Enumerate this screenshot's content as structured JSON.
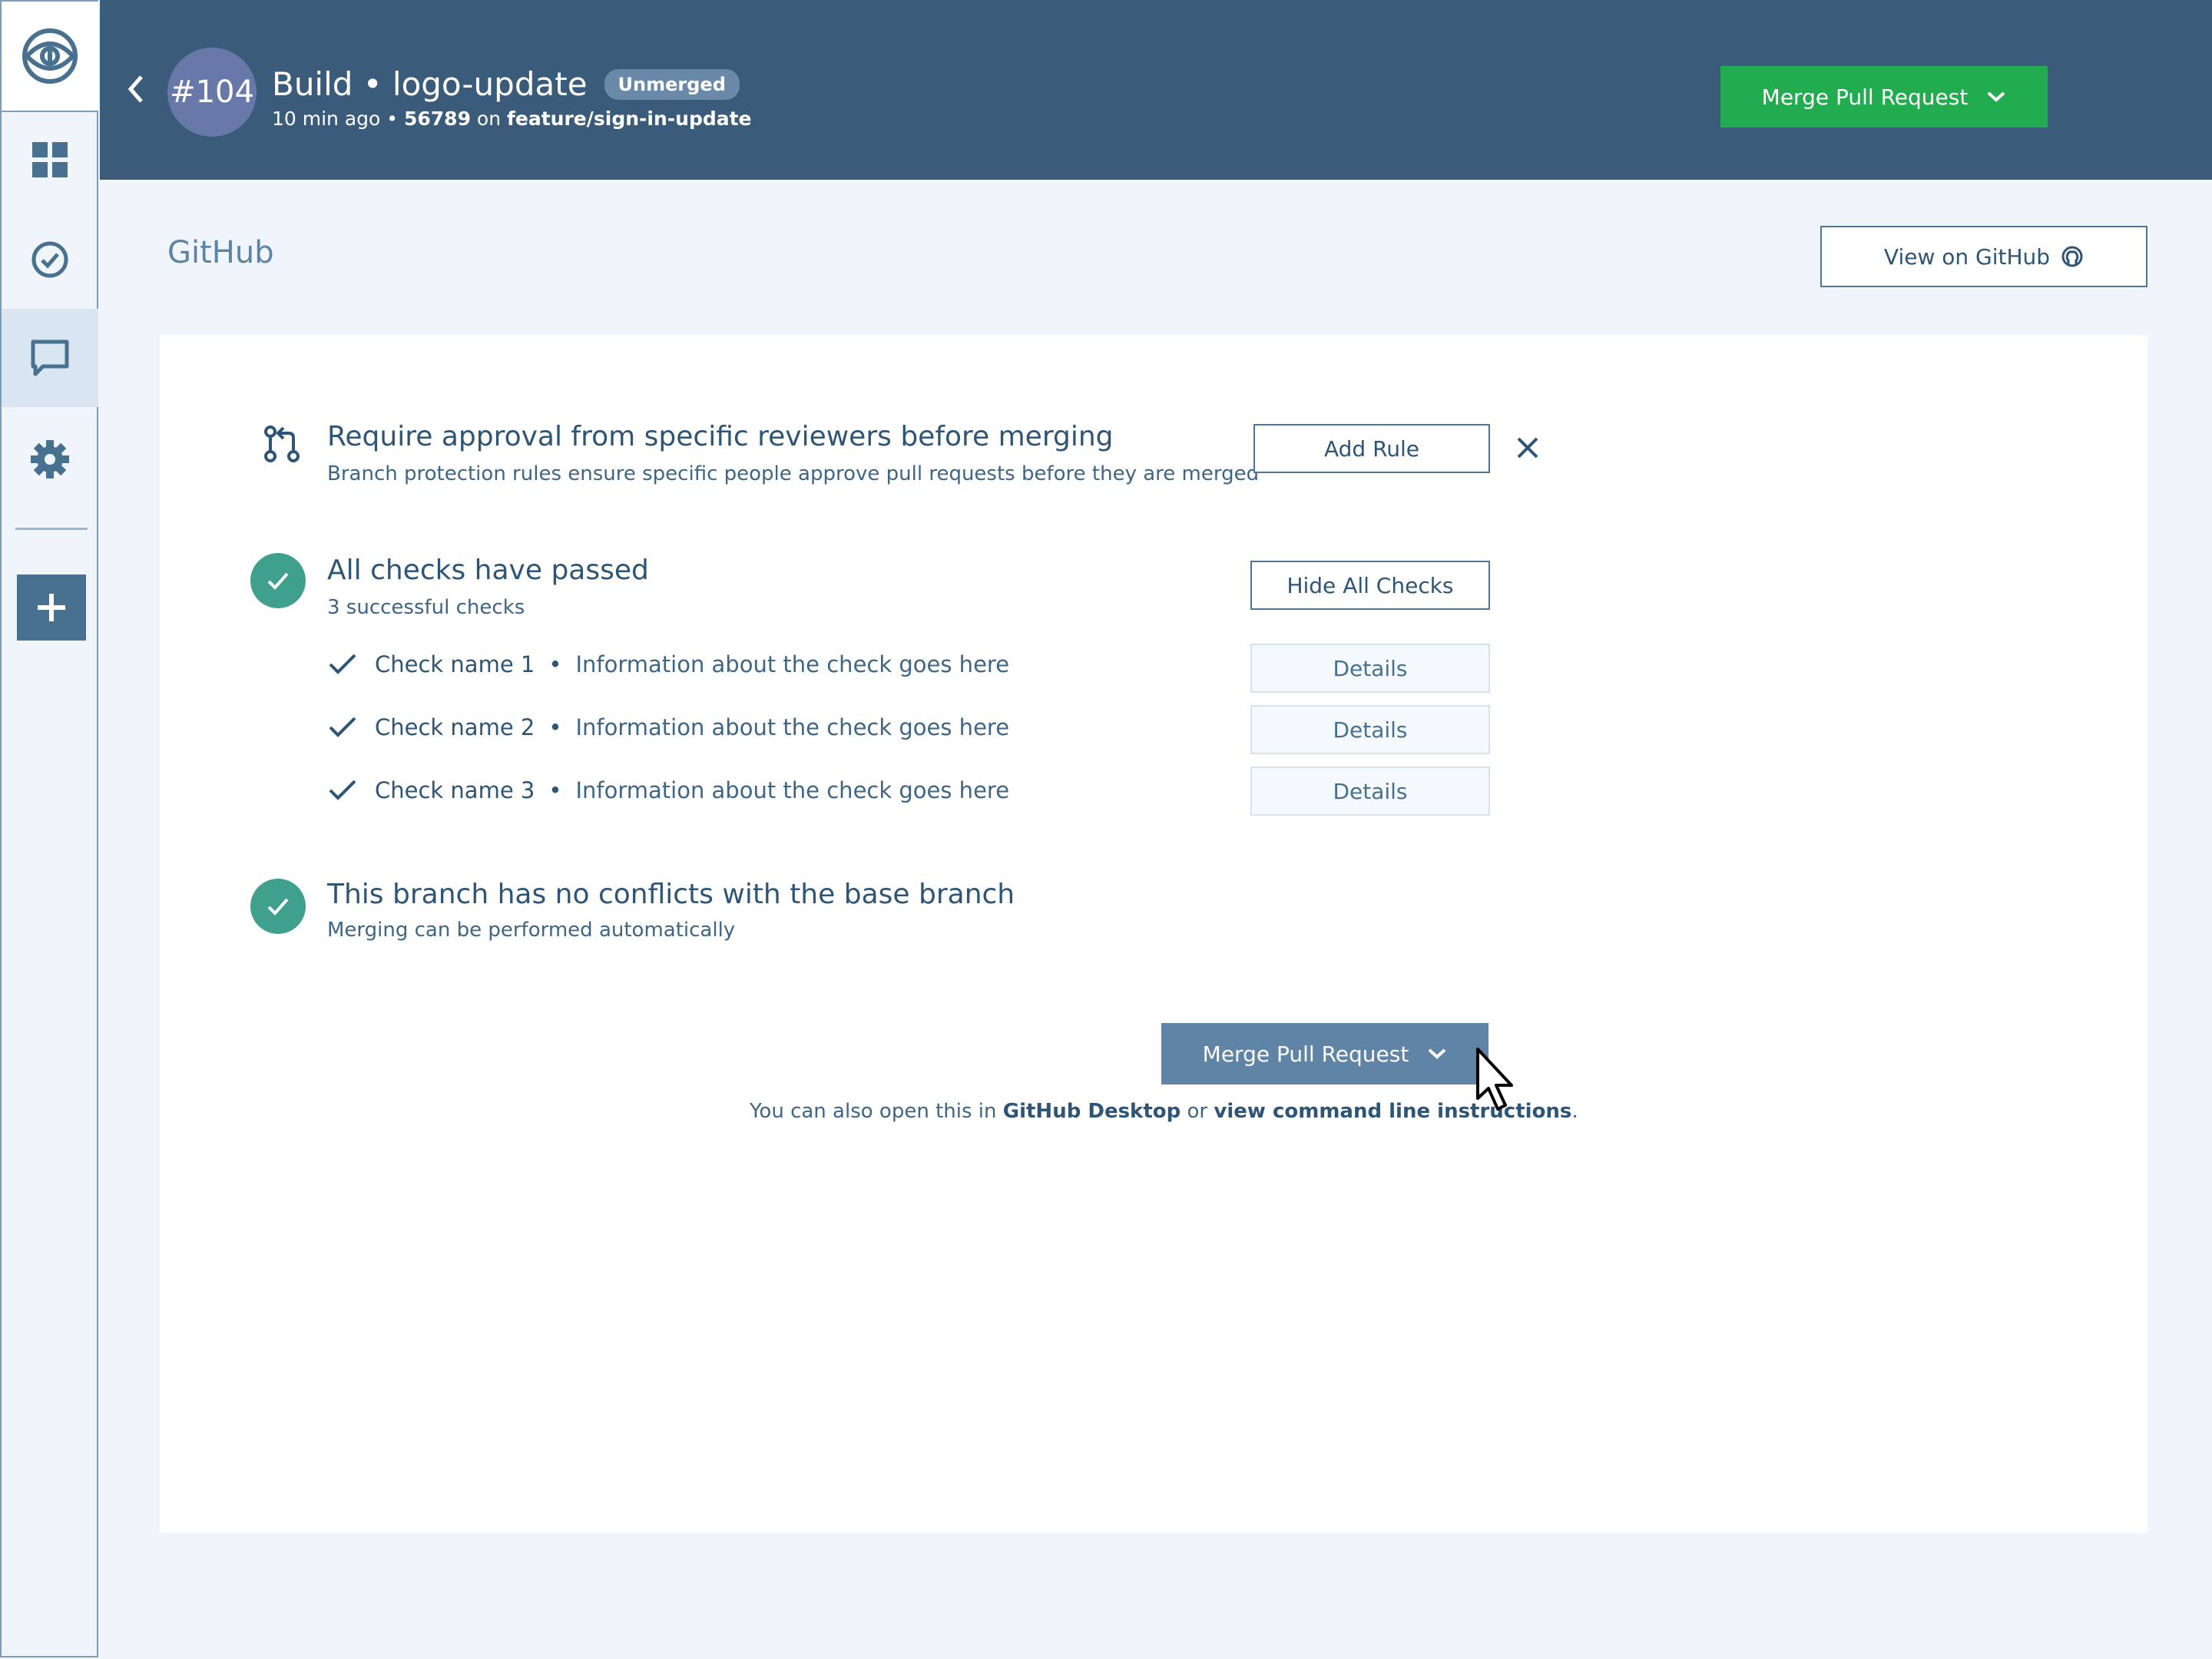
{
  "header": {
    "pr_number": "#104",
    "title": "Build • logo-update",
    "badge": "Unmerged",
    "time_ago": "10 min ago",
    "separator": " • ",
    "commit": "56789",
    "on_word": " on ",
    "branch": "feature/sign-in-update",
    "merge_label": "Merge Pull Request"
  },
  "section": {
    "title": "GitHub",
    "view_label": "View on GitHub"
  },
  "rule": {
    "title": "Require approval from specific reviewers before merging",
    "subtitle": "Branch protection rules ensure specific people approve pull requests before they are merged",
    "add_label": "Add Rule"
  },
  "checks": {
    "title": "All checks have passed",
    "subtitle": "3 successful checks",
    "hide_label": "Hide All Checks",
    "items": [
      {
        "name": "Check name 1",
        "info": "Information about the check goes here",
        "details": "Details"
      },
      {
        "name": "Check name 2",
        "info": "Information about the check goes here",
        "details": "Details"
      },
      {
        "name": "Check name 3",
        "info": "Information about the check goes here",
        "details": "Details"
      }
    ]
  },
  "conflicts": {
    "title": "This branch has no conflicts with the base branch",
    "subtitle": "Merging can be performed automatically"
  },
  "footer": {
    "merge_label": "Merge Pull Request",
    "prefix": "You can also open this in ",
    "desktop_link": "GitHub Desktop",
    "or_word": " or ",
    "cli_link": "view command line instructions",
    "suffix": "."
  },
  "icons": {
    "logo": "eye-logo-icon",
    "nav": [
      "dashboard-icon",
      "check-circle-icon",
      "comment-icon",
      "gear-icon"
    ],
    "add": "plus-icon"
  },
  "colors": {
    "header": "#3a5c7a",
    "merge_green": "#21ad4f",
    "check_teal": "#3fa08e",
    "merge_muted": "#5f84a5"
  }
}
